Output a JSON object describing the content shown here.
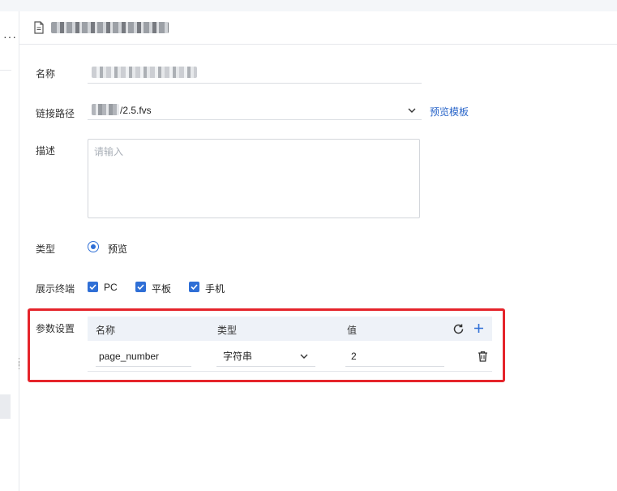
{
  "left_panel": {
    "more_glyph": "···"
  },
  "header": {
    "doc_icon": "document-icon",
    "title_redacted": true
  },
  "form": {
    "name": {
      "label": "名称",
      "value_redacted": true
    },
    "link_path": {
      "label": "链接路径",
      "value_suffix": "/2.5.fvs",
      "preview_link": "预览模板"
    },
    "description": {
      "label": "描述",
      "placeholder": "请输入"
    },
    "type": {
      "label": "类型",
      "option": "预览",
      "selected": true
    },
    "terminals": {
      "label": "展示终端",
      "options": [
        {
          "label": "PC",
          "checked": true
        },
        {
          "label": "平板",
          "checked": true
        },
        {
          "label": "手机",
          "checked": true
        }
      ]
    },
    "params": {
      "label": "参数设置",
      "columns": {
        "name": "名称",
        "type": "类型",
        "value": "值"
      },
      "rows": [
        {
          "name": "page_number",
          "type": "字符串",
          "value": "2"
        }
      ],
      "icons": {
        "refresh": "refresh-icon",
        "add": "plus-icon",
        "delete": "trash-icon"
      }
    }
  },
  "colors": {
    "accent": "#2f6fd6",
    "link": "#2965c9",
    "highlight_box": "#e5242b",
    "header_bg": "#eef2f8"
  }
}
